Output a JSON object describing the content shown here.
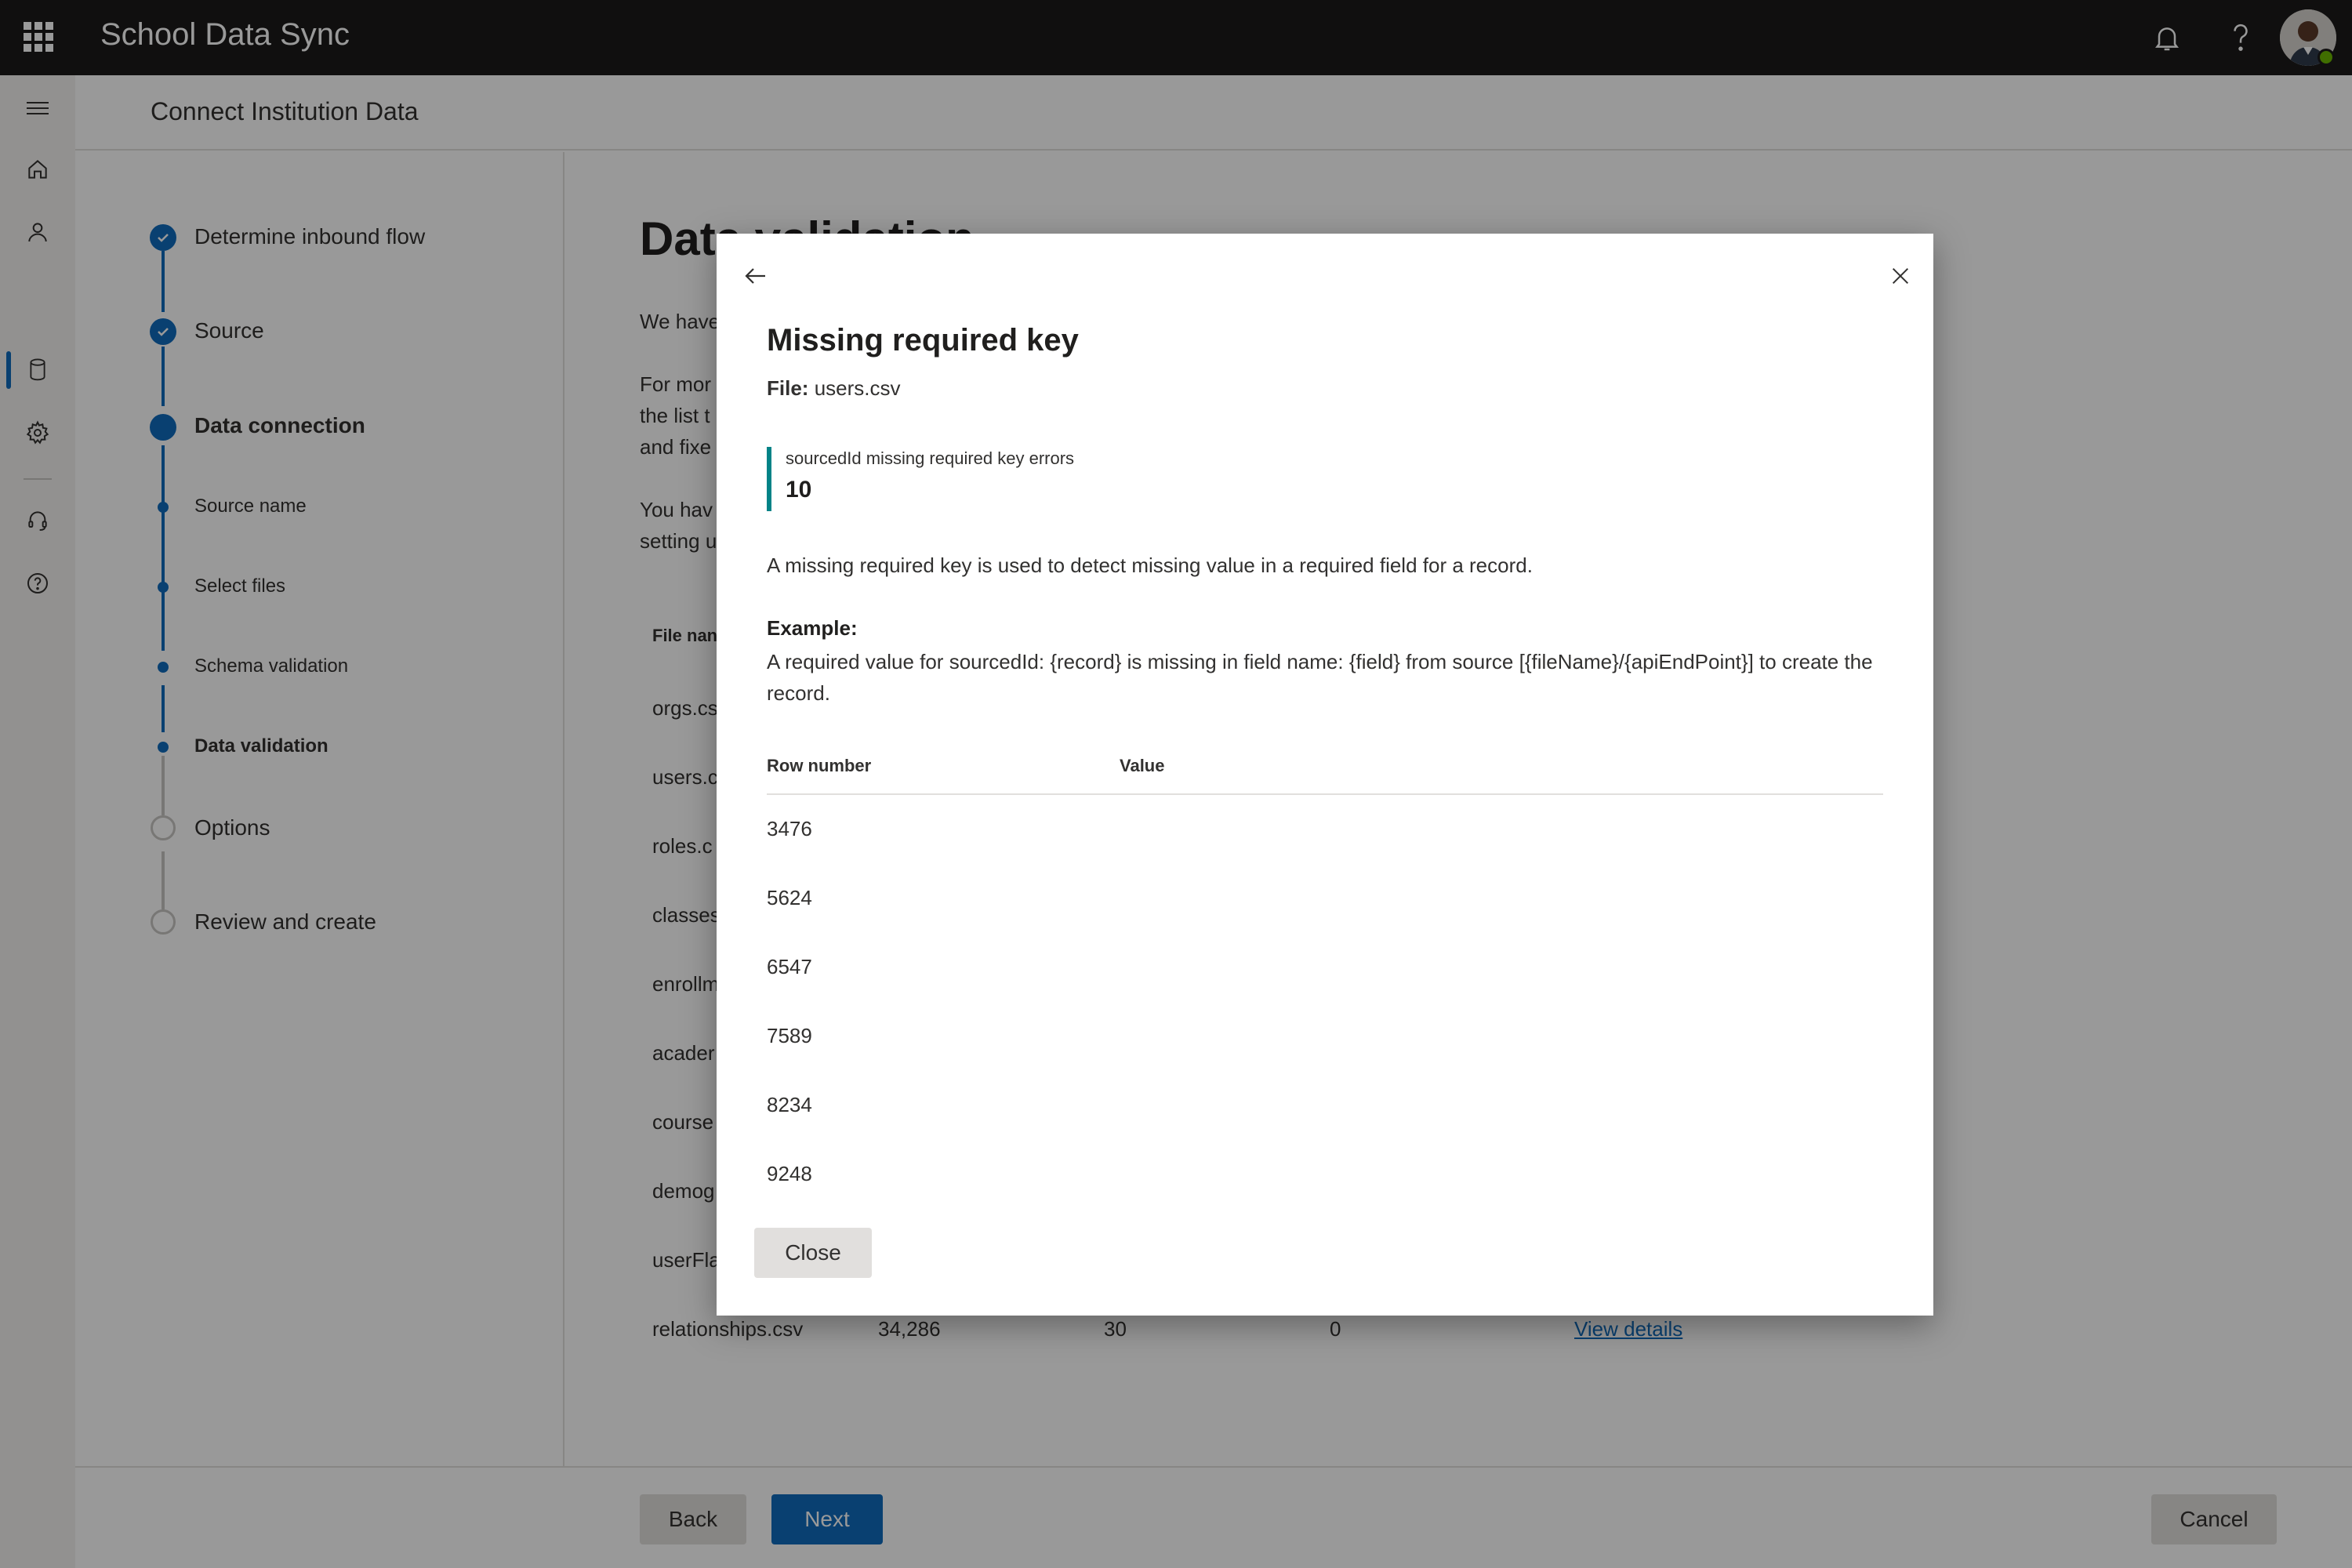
{
  "app": {
    "title": "School Data Sync",
    "icons": [
      "waffle-icon",
      "bell-icon",
      "help-icon",
      "avatar"
    ]
  },
  "rail": {
    "icons": [
      "hamburger-icon",
      "home-icon",
      "person-icon",
      "database-icon",
      "gear-icon",
      "headset-icon",
      "help-circle-icon"
    ]
  },
  "header": {
    "title": "Connect Institution Data"
  },
  "stepper": {
    "steps": [
      {
        "label": "Determine inbound flow",
        "state": "complete"
      },
      {
        "label": "Source",
        "state": "complete"
      },
      {
        "label": "Data connection",
        "state": "current"
      },
      {
        "label": "Source name",
        "state": "substep"
      },
      {
        "label": "Select files",
        "state": "substep"
      },
      {
        "label": "Schema validation",
        "state": "substep"
      },
      {
        "label": "Data validation",
        "state": "substep-current"
      },
      {
        "label": "Options",
        "state": "pending"
      },
      {
        "label": "Review and create",
        "state": "pending"
      }
    ]
  },
  "main": {
    "title": "Data validation",
    "paragraphs": [
      "We have",
      "For mor",
      "the list t",
      "and fixe",
      "You hav",
      "setting u"
    ],
    "column_header": "File nan",
    "files": [
      "orgs.cs",
      "users.c",
      "roles.c",
      "classes",
      "enrollm",
      "acader",
      "course",
      "demog",
      "userFla",
      "relationships.csv"
    ],
    "last_row": {
      "records": "34,286",
      "errors": "30",
      "warnings": "0",
      "link": "View details"
    }
  },
  "footer": {
    "back": "Back",
    "next": "Next",
    "cancel": "Cancel"
  },
  "dialog": {
    "title": "Missing required key",
    "file_label": "File:",
    "file_name": "users.csv",
    "metric_label": "sourcedId missing required key errors",
    "metric_value": "10",
    "description": "A missing required key is used to detect missing value in a required field for a record.",
    "example_label": "Example:",
    "example_text": "A required value for sourcedId: {record} is missing in field name: {field} from source [{fileName}/{apiEndPoint}] to create the record.",
    "table": {
      "headers": [
        "Row number",
        "Value"
      ],
      "rows": [
        "3476",
        "5624",
        "6547",
        "7589",
        "8234",
        "9248"
      ]
    },
    "close_label": "Close",
    "accent_color": "#038387"
  },
  "colors": {
    "brand": "#0f6cbd",
    "topbar": "#1b1a19",
    "presence": "#6bb700"
  }
}
